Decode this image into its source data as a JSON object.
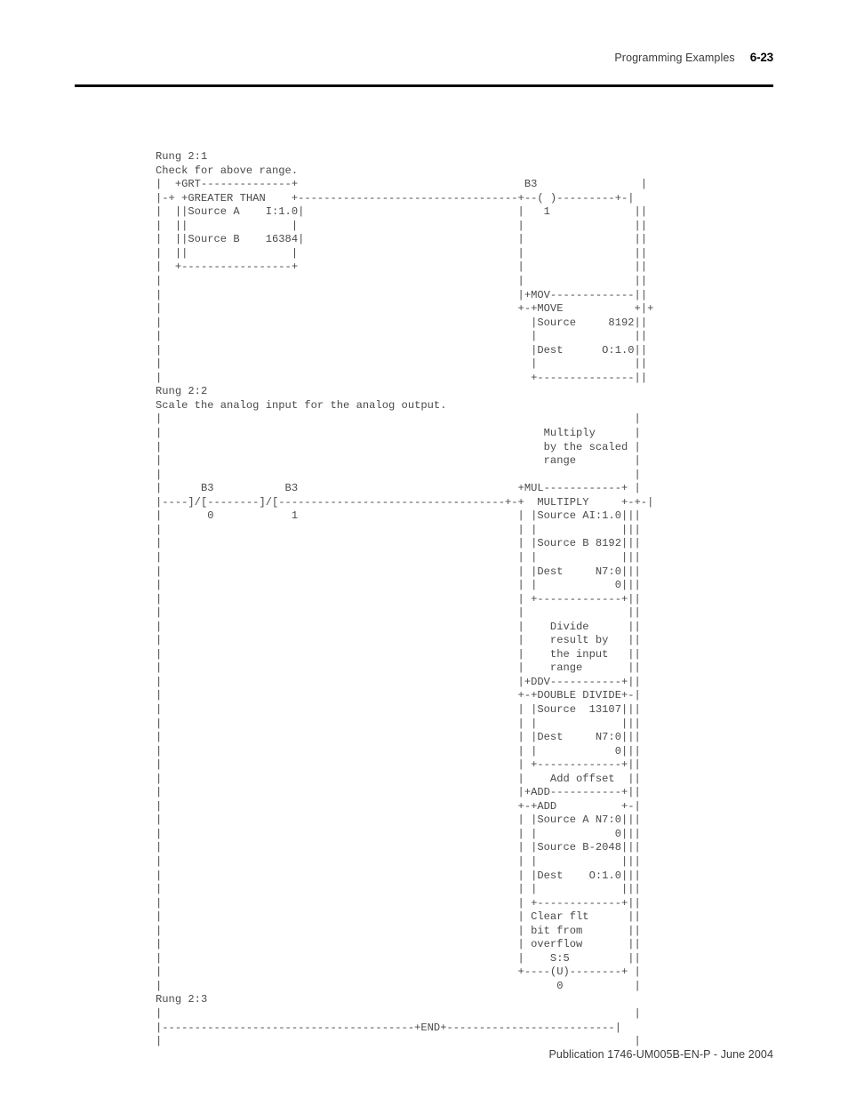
{
  "header": {
    "title": "Programming Examples",
    "page_number": "6-23"
  },
  "footer": {
    "publication": "Publication 1746-UM005B-EN-P - June 2004"
  },
  "listing": {
    "description": "SLC 500 ladder logic program listing rendered as monospaced ASCII art",
    "rungs": [
      {
        "id": "Rung 2:1",
        "comment": "Check for above range.",
        "instructions": [
          {
            "mnemonic": "GRT",
            "name": "GREATER THAN",
            "operands": [
              {
                "label": "Source A",
                "value": "I:1.0"
              },
              {
                "label": "Source B",
                "value": "16384"
              }
            ]
          },
          {
            "mnemonic": "OTE",
            "name": "output coil",
            "symbol": "-( )-",
            "address_file": "B3",
            "address_bit": "1"
          },
          {
            "mnemonic": "MOV",
            "name": "MOVE",
            "operands": [
              {
                "label": "Source",
                "value": "8192"
              },
              {
                "label": "Dest",
                "value": "O:1.0"
              }
            ]
          }
        ]
      },
      {
        "id": "Rung 2:2",
        "comment": "Scale the analog input for the analog output.",
        "instructions": [
          {
            "mnemonic": "XIO",
            "name": "examine if open",
            "symbol": "]/[",
            "address_file": "B3",
            "address_bit": "0"
          },
          {
            "mnemonic": "XIO",
            "name": "examine if open",
            "symbol": "]/[",
            "address_file": "B3",
            "address_bit": "1"
          },
          {
            "mnemonic": "MUL",
            "name": "MULTIPLY",
            "note": "Multiply by the scaled range",
            "operands": [
              {
                "label": "Source A",
                "value": "I:1.0"
              },
              {
                "label": "Source B",
                "value": "8192"
              },
              {
                "label": "Dest",
                "value": "N7:0",
                "current": "0"
              }
            ]
          },
          {
            "mnemonic": "DDV",
            "name": "DOUBLE DIVIDE",
            "note": "Divide result by the input range",
            "operands": [
              {
                "label": "Source",
                "value": "13107"
              },
              {
                "label": "Dest",
                "value": "N7:0",
                "current": "0"
              }
            ]
          },
          {
            "mnemonic": "ADD",
            "name": "ADD",
            "note": "Add offset",
            "operands": [
              {
                "label": "Source A",
                "value": "N7:0",
                "current": "0"
              },
              {
                "label": "Source B",
                "value": "-2048"
              },
              {
                "label": "Dest",
                "value": "O:1.0"
              }
            ]
          },
          {
            "mnemonic": "OTU",
            "name": "unlatch coil",
            "symbol": "-(U)-",
            "note": "Clear flt bit from overflow",
            "address_file": "S:5",
            "address_bit": "0"
          }
        ]
      },
      {
        "id": "Rung 2:3",
        "comment": "",
        "instructions": [
          {
            "mnemonic": "END",
            "name": "END",
            "symbol": "+END+"
          }
        ]
      }
    ],
    "text": "Rung 2:1\nCheck for above range.\n|  +GRT--------------+                                                      |\n|-+GREATER THAN      +----------------------------------+--( )--------------+-|\n|  |Source A    I:1.0|                                   |    1              | |\n|  |                 |                                   |                   | |\n|  |Source B    16384|                                   |                   | |\n|  |                 |                                   |                   | |\n|  +-----------------+                                   |                   | |\n|                                                        |                   | |\n|                                                        |+MOV--------------+ | |\n|                                                        +-+MOVE          +-+ |\n|                                                          |Source    8192|   |\n|                                                          |              |   |\n|                                                          |Dest     O:1.0|   |\n|                                                          |              |   |\n|                                                          +--------------+   |\nRung 2:2\nScale the analog input for the analog output.\n|                                                         Multiply          |\n|                                                         by the scaled     |\n|                                                         range             |\n|                                                                           |\n|     B3        B3                                       +MUL--------------+ |\n|----]/[--------]/[--------------------------------------+-+MULTIPLY      +-+-|\n|      0         1                                       | |Source A I:1.0| | |\n|                                                        | |              | | |\n|                                                        | |Source B  8192| | |\n|                                                        | |              | | |\n|                                                        | |Dest     N7:0 | | |\n|                                                        | |            0 | | |\n|                                                        | +------------+ | |\n|                                                        |               | |\n|                                                        |  Divide       | |\n|                                                        |  result by    | |\n|                                                        |  the input    | |\n|                                                        |  range        | |\n|                                                        |+DDV----------+ | |\n|                                                        +-+DOUBLE DIVIDE+-+ |\n|                                                        | |Source 13107 | | |\n|                                                        | |             | | |\n|                                                        | |Dest    N7:0 | | |\n|                                                        | |           0 | | |\n|                                                        | +-----------+ | |\n|                                                        |  Add offset   | |\n|                                                        |+ADD---------+ | |\n|                                                        +-+ADD        +-+ |\n|                                                        | |Source A N7:0| |\n|                                                        | |           0 | |\n|                                                        | |Source B -2048|\n|                                                        | |             |\n|                                                        | |Dest    O:1.0|\n|                                                        | |             |\n|                                                        | +-----------+ |\n|                                                        | Clear flt     |\n|                                                        | bit from      |\n|                                                        | overflow      |\n|                                                        |   S:5         |\n|                                                        +----(U)-------+ |\n|                                                              0          |\nRung 2:3\n|                                                                           |\n|------------------------------------+END+---------------------------------|\n|                                                                           |",
    "lines": [
      "Rung 2:1",
      "Check for above range.",
      "|  +GRT--------------+                                     B3              |",
      "|-+GREATER THAN      +----------------------------------+--( )--------------+-|",
      "|  |Source A    I:1.0|                                   |    1              | |",
      "|  |                 |                                   |                   | |",
      "|  |Source B    16384|                                   |                   | |",
      "|  |                 |                                   |                   | |",
      "|  +-----------------+                                   |                   | |",
      "|                                                        |                   | |",
      "|                                                        |+MOV--------------+ | |",
      "|                                                        +-+MOVE          +-+ |",
      "|                                                          |Source    8192|   |",
      "|                                                          |              |   |",
      "|                                                          |Dest     O:1.0|   |",
      "|                                                          |              |   |",
      "|                                                          +--------------+   |"
    ]
  }
}
